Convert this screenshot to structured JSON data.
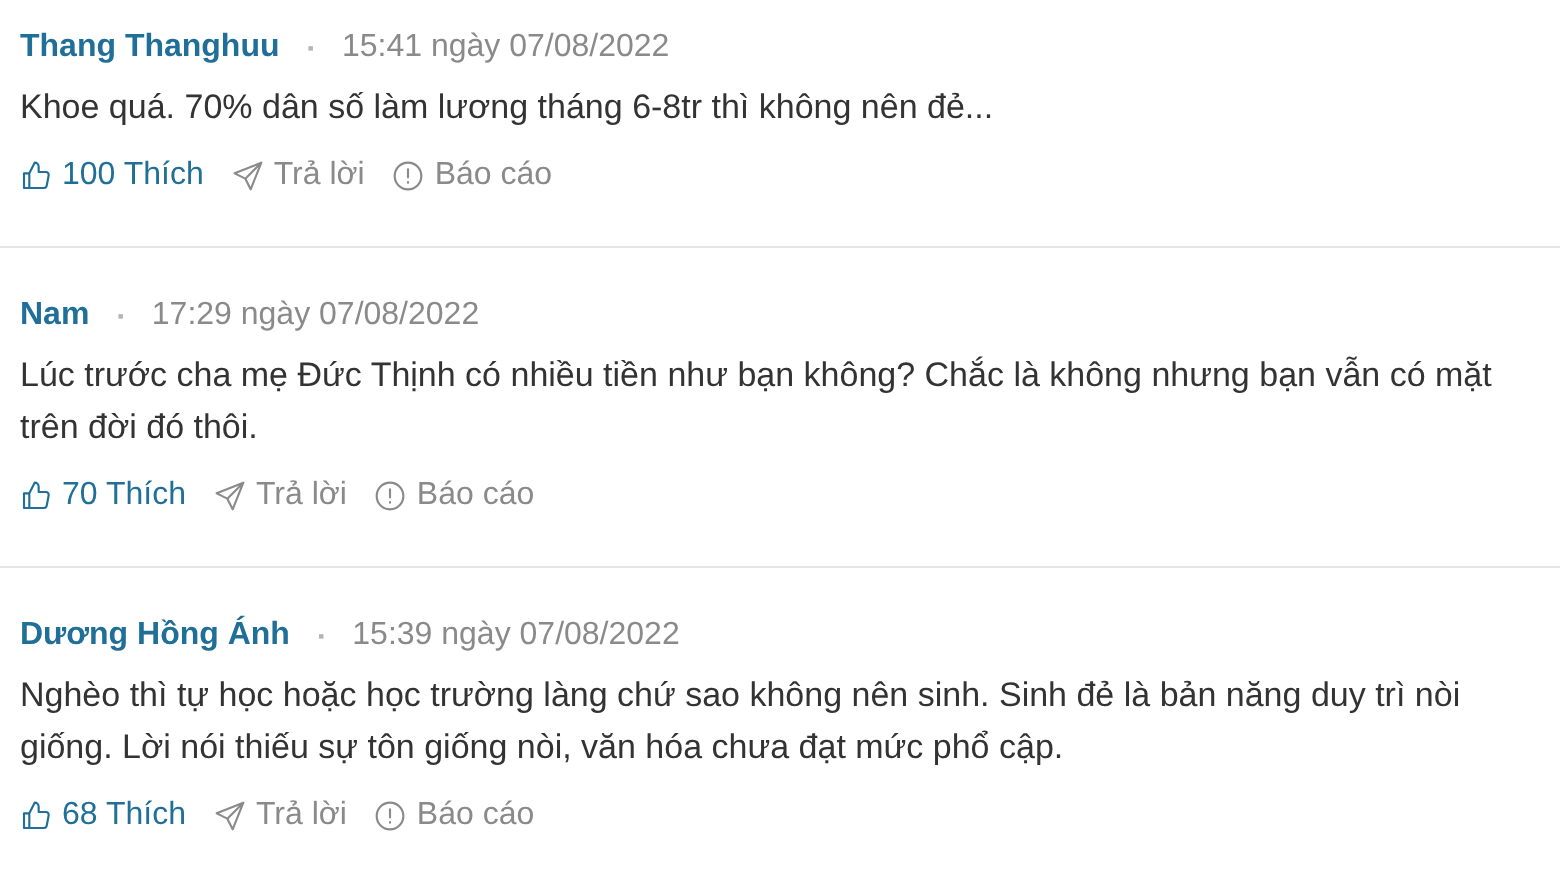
{
  "comments": [
    {
      "author": "Thang Thanghuu",
      "separator": "▪",
      "time": "15:41 ngày 07/08/2022",
      "text": "Khoe quá. 70% dân số làm lương tháng 6-8tr thì không nên đẻ...",
      "likes": "100 Thích",
      "reply": "Trả lời",
      "report": "Báo cáo"
    },
    {
      "author": "Nam",
      "separator": "▪",
      "time": "17:29 ngày 07/08/2022",
      "text": "Lúc trước cha mẹ Đức Thịnh có nhiều tiền như bạn không? Chắc là không nhưng bạn vẫn có mặt trên đời đó thôi.",
      "likes": "70 Thích",
      "reply": "Trả lời",
      "report": "Báo cáo"
    },
    {
      "author": "Dương Hồng Ánh",
      "separator": "▪",
      "time": "15:39 ngày 07/08/2022",
      "text": "Nghèo thì tự học hoặc học trường làng chứ sao không nên sinh. Sinh đẻ là bản năng duy trì nòi giống. Lời nói thiếu sự tôn giống nòi, văn hóa chưa đạt mức phổ cập.",
      "likes": "68 Thích",
      "reply": "Trả lời",
      "report": "Báo cáo"
    }
  ]
}
